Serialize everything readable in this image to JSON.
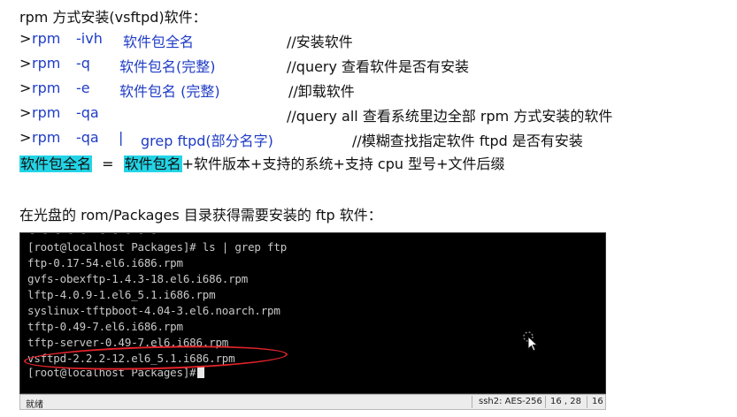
{
  "heading": "rpm 方式安装(vsftpd)软件：",
  "commands": [
    {
      "prompt": ">",
      "cmd": "rpm",
      "flag": "-ivh",
      "arg": "软件包全名",
      "comment": "//安装软件"
    },
    {
      "prompt": ">",
      "cmd": "rpm",
      "flag": "-q",
      "arg": "软件包名(完整)",
      "comment": "//query 查看软件是否有安装"
    },
    {
      "prompt": ">",
      "cmd": "rpm",
      "flag": "-e",
      "arg": "软件包名 (完整)",
      "comment": "//卸载软件"
    },
    {
      "prompt": ">",
      "cmd": "rpm",
      "flag": "-qa",
      "arg": "",
      "comment": "//query all   查看系统里边全部 rpm 方式安装的软件"
    },
    {
      "prompt": ">",
      "cmd": "rpm",
      "flag": "-qa",
      "pipe": "|",
      "arg": "grep ftpd(部分名字)",
      "comment": "//模糊查找指定软件 ftpd 是否有安装"
    }
  ],
  "formula": {
    "full_name": "软件包全名",
    "equals": "=",
    "pkg_name": "软件包名",
    "rest": "+软件版本+支持的系统+支持 cpu 型号+文件后缀"
  },
  "section2": "在光盘的 rom/Packages 目录获得需要安装的 ftp 软件：",
  "terminal": {
    "ghost": "- - - - -  - - - - -",
    "lines": [
      "[root@localhost Packages]# ls | grep ftp",
      "ftp-0.17-54.el6.i686.rpm",
      "gvfs-obexftp-1.4.3-18.el6.i686.rpm",
      "lftp-4.0.9-1.el6_5.1.i686.rpm",
      "syslinux-tftpboot-4.04-3.el6.noarch.rpm",
      "tftp-0.49-7.el6.i686.rpm",
      "tftp-server-0.49-7.el6.i686.rpm",
      "vsftpd-2.2.2-12.el6_5.1.i686.rpm",
      "[root@localhost Packages]#"
    ],
    "highlight_color": "#e0242a"
  },
  "statusbar": {
    "ready": "就绪",
    "protocol": "ssh2: AES-256",
    "position": "16 ,  28",
    "rows": "16"
  },
  "colors": {
    "command_text": "#1f3cc6",
    "highlight_bg": "#23d4e6"
  }
}
